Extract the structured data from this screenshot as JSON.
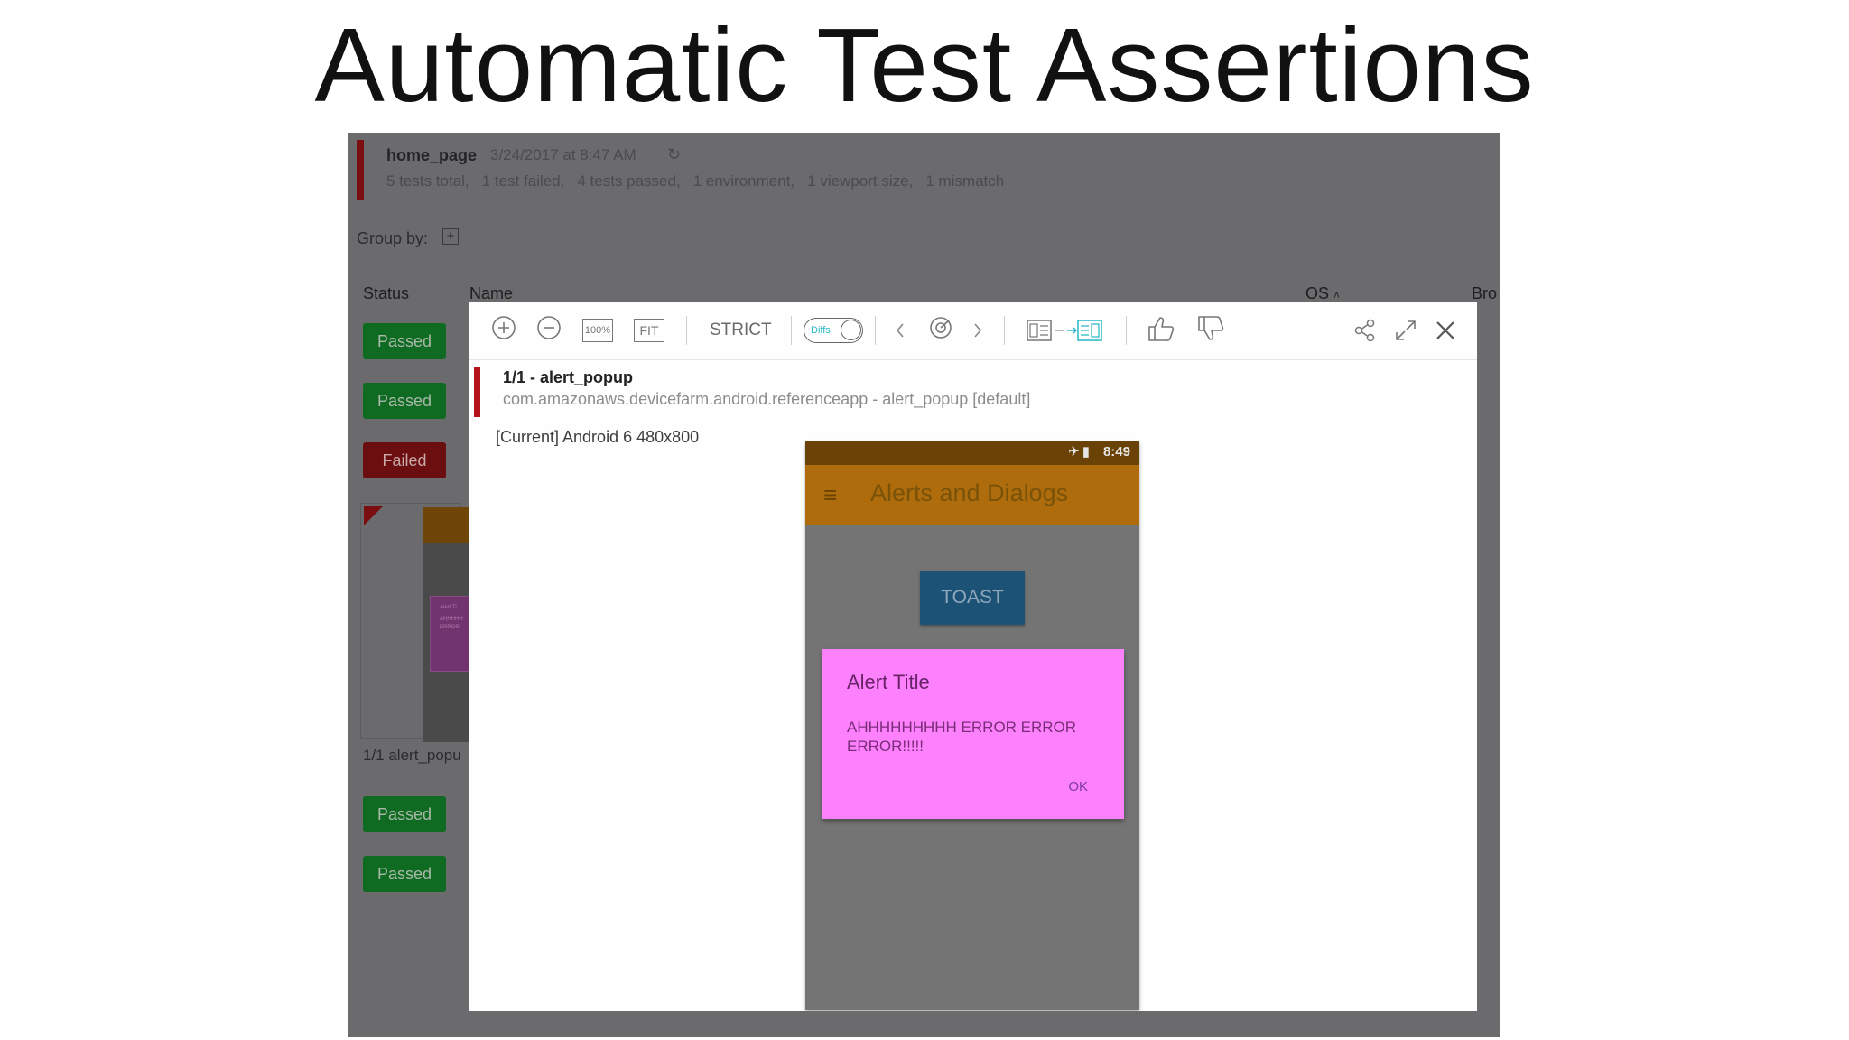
{
  "slide": {
    "title": "Automatic Test Assertions"
  },
  "batch": {
    "name": "home_page",
    "date": "3/24/2017 at 8:47 AM",
    "summary": [
      "5 tests total,",
      "1 test failed,",
      "4 tests passed,",
      "1 environment,",
      "1 viewport size,",
      "1 mismatch"
    ],
    "group_by_label": "Group by:",
    "group_by_add": "+"
  },
  "table": {
    "columns": {
      "status": "Status",
      "name": "Name",
      "os": "OS",
      "browser": "Bro"
    },
    "statuses": [
      "Passed",
      "Passed",
      "Failed",
      "Passed",
      "Passed"
    ],
    "thumb_label": "1/1  alert_popu",
    "thumb_alert_lines": [
      "Alert Ti",
      "AHHHHH",
      "ERROR!"
    ]
  },
  "toolbar": {
    "zoom_100": "100%",
    "fit": "FIT",
    "strict": "STRICT",
    "diffs": "Diffs"
  },
  "step": {
    "title": "1/1 - alert_popup",
    "subtitle": "com.amazonaws.devicefarm.android.referenceapp - alert_popup [default]",
    "environment": "[Current] Android 6 480x800"
  },
  "phone": {
    "time": "8:49",
    "appbar_title": "Alerts and Dialogs",
    "toast_button": "TOAST",
    "alert": {
      "title": "Alert Title",
      "message": "AHHHHHHHHH ERROR ERROR ERROR!!!!!",
      "ok": "OK"
    }
  },
  "icons": [
    "zoom-in-icon",
    "zoom-out-icon",
    "chevron-left-icon",
    "target-icon",
    "chevron-right-icon",
    "compare-layout-icon",
    "thumbs-up-icon",
    "thumbs-down-icon",
    "share-icon",
    "expand-icon",
    "close-icon",
    "refresh-icon",
    "menu-icon"
  ],
  "colors": {
    "passed": "#0f6a22",
    "failed": "#6a0e10",
    "step_marker": "#b5121b",
    "alert_bg": "#fd80fc",
    "appbar": "#af6c0c",
    "diffs_accent": "#26b7c6"
  }
}
